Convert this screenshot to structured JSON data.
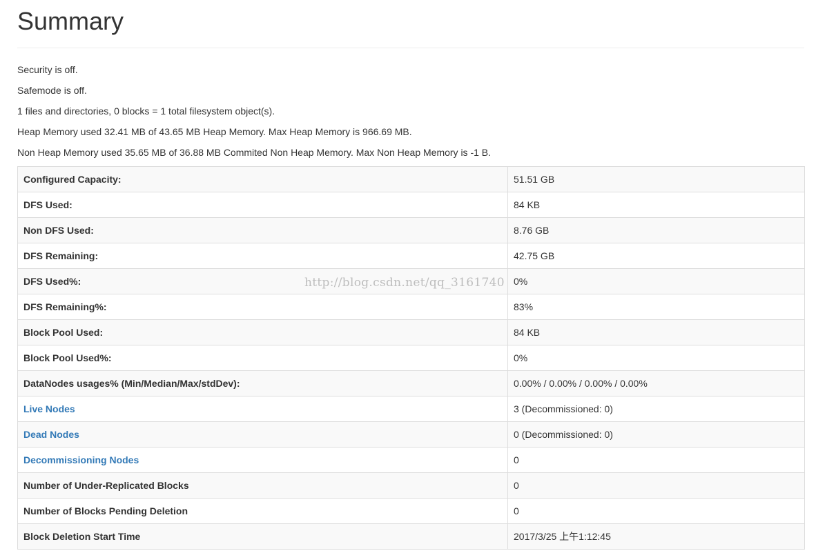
{
  "header": {
    "title": "Summary"
  },
  "info": [
    "Security is off.",
    "Safemode is off.",
    "1 files and directories, 0 blocks = 1 total filesystem object(s).",
    "Heap Memory used 32.41 MB of 43.65 MB Heap Memory. Max Heap Memory is 966.69 MB.",
    "Non Heap Memory used 35.65 MB of 36.88 MB Commited Non Heap Memory. Max Non Heap Memory is -1 B."
  ],
  "table": {
    "rows": [
      {
        "key": "Configured Capacity:",
        "value": "51.51 GB"
      },
      {
        "key": "DFS Used:",
        "value": "84 KB"
      },
      {
        "key": "Non DFS Used:",
        "value": "8.76 GB"
      },
      {
        "key": "DFS Remaining:",
        "value": "42.75 GB"
      },
      {
        "key": "DFS Used%:",
        "value": "0%"
      },
      {
        "key": "DFS Remaining%:",
        "value": "83%"
      },
      {
        "key": "Block Pool Used:",
        "value": "84 KB"
      },
      {
        "key": "Block Pool Used%:",
        "value": "0%"
      },
      {
        "key": "DataNodes usages% (Min/Median/Max/stdDev):",
        "value": "0.00% / 0.00% / 0.00% / 0.00%"
      },
      {
        "key": "Live Nodes",
        "value": "3 (Decommissioned: 0)"
      },
      {
        "key": "Dead Nodes",
        "value": "0 (Decommissioned: 0)"
      },
      {
        "key": "Decommissioning Nodes",
        "value": "0"
      },
      {
        "key": "Number of Under-Replicated Blocks",
        "value": "0"
      },
      {
        "key": "Number of Blocks Pending Deletion",
        "value": "0"
      },
      {
        "key": "Block Deletion Start Time",
        "value": "2017/3/25 上午1:12:45"
      }
    ]
  },
  "watermark": "http://blog.csdn.net/qq_3161740",
  "colors": {
    "link": "#337ab7",
    "text": "#333333",
    "border": "#dddddd",
    "stripe": "#f9f9f9"
  }
}
